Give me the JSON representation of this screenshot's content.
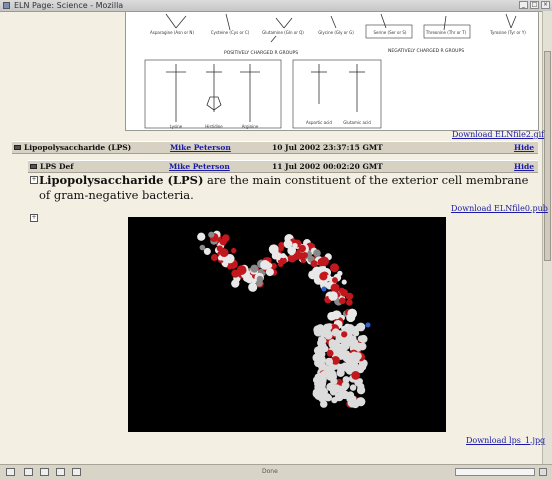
{
  "window": {
    "title": "ELN Page: Science - Mozilla"
  },
  "figure1": {
    "row1": [
      "Asparagine\n(Asn or N)",
      "Cysteine\n(Cys or C)",
      "Glutamine\n(Gln or Q)",
      "Glycine\n(Gly or G)",
      "Serine\n(Ser or S)",
      "Threonine\n(Thr or T)",
      "Tyrosine\n(Tyr or Y)"
    ],
    "group_pos": "POSITIVELY CHARGED R GROUPS",
    "group_neg": "NEGATIVELY CHARGED R GROUPS",
    "bottom_labels": [
      "Lysine",
      "Histidine",
      "Arginine",
      "Aspartic\nacid",
      "Glutamic\nacid"
    ]
  },
  "download1": "Download ELNfile2.gif",
  "entry1": {
    "title": "Lipopolysaccharide (LPS)",
    "author": "Mike Peterson",
    "date": "10 Jul 2002 23:37:15 GMT",
    "hide": "Hide"
  },
  "entry2": {
    "title": "LPS Def",
    "author": "Mike Peterson",
    "date": "11 Jul 2002 00:02:20 GMT",
    "hide": "Hide"
  },
  "lps": {
    "bold": "Lipopolysaccharide (LPS)",
    "rest": " are the main constituent of the exterior cell membrane of gram-negative bacteria."
  },
  "download2": "Download ELNfile0.pub",
  "download3": "Download lps_1.jpg",
  "status": {
    "text": "Done"
  },
  "colors": {
    "link": "#1a1aa6",
    "header_bg": "#d6d1c3",
    "page_bg": "#f3efe3"
  }
}
